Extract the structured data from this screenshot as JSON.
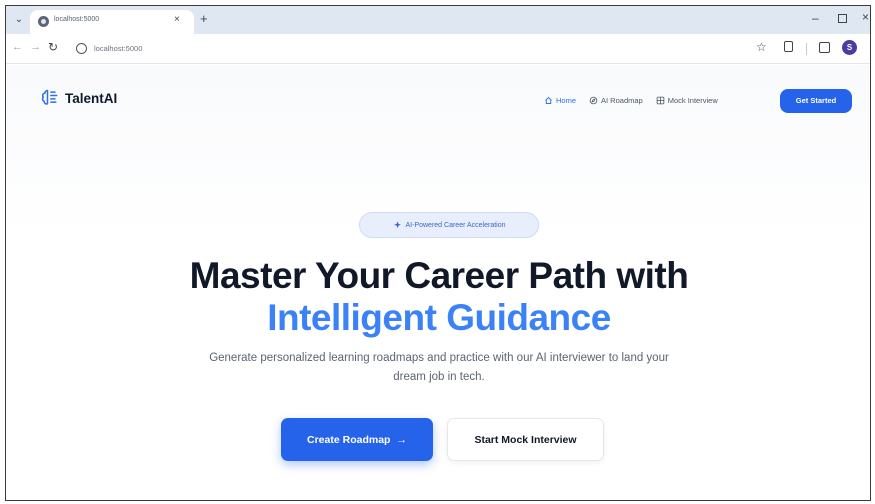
{
  "browser": {
    "tab_title": "localhost:5000",
    "url": "localhost:5000",
    "profile_initial": "S"
  },
  "brand": {
    "name": "TalentAI"
  },
  "nav": {
    "items": [
      {
        "label": "Home",
        "icon": "home-icon"
      },
      {
        "label": "AI Roadmap",
        "icon": "compass-icon"
      },
      {
        "label": "Mock Interview",
        "icon": "grid-icon"
      }
    ],
    "cta": "Get Started"
  },
  "hero": {
    "badge": "AI-Powered Career Acceleration",
    "title_line1": "Master Your Career Path with",
    "title_line2": "Intelligent Guidance",
    "subtitle": "Generate personalized learning roadmaps and practice with our AI interviewer to land your dream job in tech.",
    "primary_button": "Create Roadmap",
    "primary_arrow": "→",
    "secondary_button": "Start Mock Interview"
  },
  "colors": {
    "accent": "#2563eb",
    "accent_light": "#3b82f6",
    "text_dark": "#111827"
  }
}
